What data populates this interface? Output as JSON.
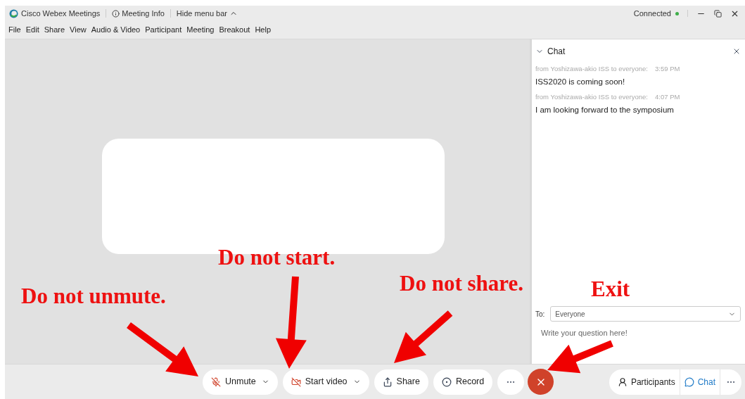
{
  "window": {
    "app_title": "Cisco Webex Meetings",
    "meeting_info": "Meeting Info",
    "hide_menu_bar": "Hide menu bar",
    "status": "Connected",
    "connected": true
  },
  "menu": [
    "File",
    "Edit",
    "Share",
    "View",
    "Audio & Video",
    "Participant",
    "Meeting",
    "Breakout",
    "Help"
  ],
  "chat": {
    "title": "Chat",
    "messages": [
      {
        "sender": "from Yoshizawa-akio ISS to everyone:",
        "time": "3:59 PM",
        "text": "ISS2020 is coming soon!"
      },
      {
        "sender": "from Yoshizawa-akio ISS to everyone:",
        "time": "4:07 PM",
        "text": "I am looking forward to the symposium"
      }
    ],
    "to_label": "To:",
    "recipient": "Everyone",
    "placeholder": "Write your question here!"
  },
  "toolbar": {
    "controls": [
      {
        "kind": "mute",
        "label": "Unmute",
        "dropdown": true
      },
      {
        "kind": "video",
        "label": "Start video",
        "dropdown": true
      },
      {
        "kind": "share",
        "label": "Share",
        "dropdown": false
      },
      {
        "kind": "record",
        "label": "Record",
        "dropdown": false
      }
    ],
    "panels": [
      {
        "kind": "participants",
        "label": "Participants",
        "selected": false
      },
      {
        "kind": "chat",
        "label": "Chat",
        "selected": true
      }
    ]
  },
  "annotations": [
    {
      "text": "Do not unmute."
    },
    {
      "text": "Do not start."
    },
    {
      "text": "Do not share."
    },
    {
      "text": "Exit"
    }
  ]
}
